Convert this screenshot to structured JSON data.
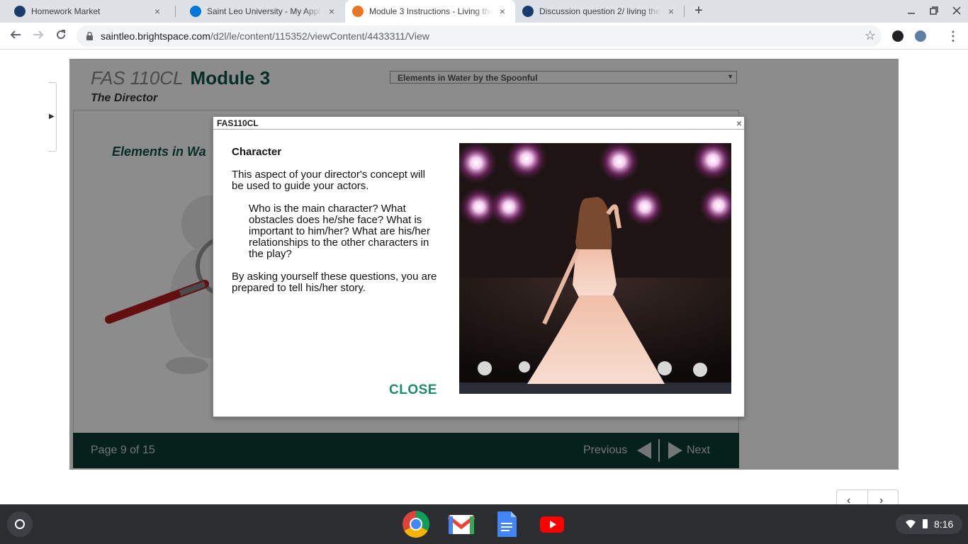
{
  "tabs": [
    {
      "title": "Homework Market",
      "favicon_color": "#1a3d6d"
    },
    {
      "title": "Saint Leo University - My Applications",
      "favicon_color": "#0078d7"
    },
    {
      "title": "Module 3 Instructions - Living the",
      "favicon_color": "#e87722"
    },
    {
      "title": "Discussion question 2/ living the",
      "favicon_color": "#1a3d6d"
    }
  ],
  "tab_close_glyph": "×",
  "new_tab_glyph": "+",
  "address_bar": {
    "host": "saintleo.brightspace.com",
    "path": "/d2l/le/content/115352/viewContent/4433311/View"
  },
  "module": {
    "course": "FAS 110CL",
    "module_label": "Module 3",
    "subtitle": "The Director",
    "select_value": "Elements in Water by the Spoonful",
    "slide_heading": "Elements in Wa",
    "page_indicator": "Page 9 of 15",
    "prev_label": "Previous",
    "next_label": "Next"
  },
  "modal": {
    "title": "FAS110CL",
    "close_x": "×",
    "heading": "Character",
    "para1": "This aspect of your director's concept will be used to guide your actors.",
    "para2": "Who is the main character? What obstacles does he/she face? What is important to him/her? What are his/her relationships to the other characters in the play?",
    "para3": "By asking yourself these questions, you are prepared to tell his/her story.",
    "close_label": "CLOSE"
  },
  "colors": {
    "brand_green": "#0b5345",
    "footer_bg": "#0b3d33",
    "close_green": "#1e8a6d"
  },
  "shelf": {
    "apps": [
      "chrome-icon",
      "gmail-icon",
      "docs-icon",
      "youtube-icon"
    ],
    "time": "8:16"
  }
}
